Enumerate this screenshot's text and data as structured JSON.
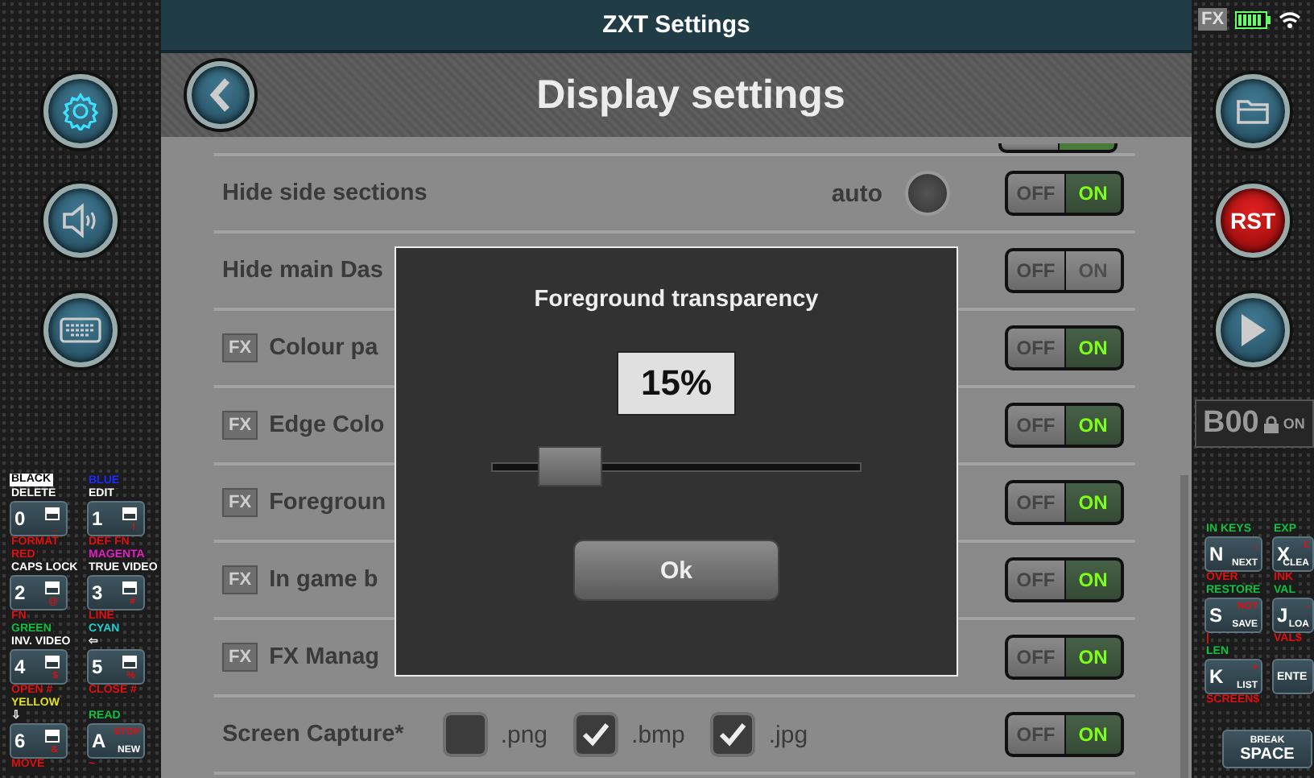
{
  "window": {
    "title": "ZXT Settings"
  },
  "header": {
    "title": "Display settings"
  },
  "settings": [
    {
      "kind": "clipped",
      "on": true
    },
    {
      "kind": "toggle",
      "label": "Hide side sections",
      "auto_label": "auto",
      "auto_on": false,
      "off_label": "OFF",
      "on_label": "ON",
      "on": true
    },
    {
      "kind": "toggle",
      "label": "Hide main Das",
      "off_label": "OFF",
      "on_label": "ON",
      "on": false
    },
    {
      "kind": "toggle",
      "fx": "FX",
      "label": "Colour pa",
      "off_label": "OFF",
      "on_label": "ON",
      "on": true
    },
    {
      "kind": "toggle",
      "fx": "FX",
      "label": "Edge Colo",
      "off_label": "OFF",
      "on_label": "ON",
      "on": true
    },
    {
      "kind": "toggle",
      "fx": "FX",
      "label": "Foregroun",
      "off_label": "OFF",
      "on_label": "ON",
      "on": true
    },
    {
      "kind": "toggle",
      "fx": "FX",
      "label": "In game b",
      "off_label": "OFF",
      "on_label": "ON",
      "on": true
    },
    {
      "kind": "toggle",
      "fx": "FX",
      "label": "FX Manag",
      "off_label": "OFF",
      "on_label": "ON",
      "on": true
    },
    {
      "kind": "capture",
      "label": "Screen Capture*",
      "formats": [
        {
          "label": ".png",
          "checked": false
        },
        {
          "label": ".bmp",
          "checked": true
        },
        {
          "label": ".jpg",
          "checked": true
        }
      ],
      "off_label": "OFF",
      "on_label": "ON",
      "on": true
    }
  ],
  "dialog": {
    "title": "Foreground transparency",
    "value": "15%",
    "level": 0.15,
    "button": "Ok"
  },
  "right_panel": {
    "fx_badge": "FX",
    "reset_button": "RST",
    "memory": {
      "slot": "B00",
      "state": "ON"
    }
  },
  "left_keys": [
    {
      "kind": "digit",
      "char": "0",
      "symbol": "_",
      "above": [
        {
          "text": "BLACK",
          "kind": "inverse",
          "color": "#000000"
        },
        {
          "text": "DELETE",
          "kind": "plain"
        }
      ],
      "below": {
        "text": "FORMAT",
        "color": "#e01010"
      }
    },
    {
      "kind": "digit",
      "char": "1",
      "symbol": "!",
      "above": [
        {
          "text": "BLUE",
          "kind": "plain",
          "color": "#1a2cff"
        },
        {
          "text": "EDIT",
          "kind": "plain"
        }
      ],
      "below": {
        "text": "DEF FN",
        "color": "#e01010"
      }
    },
    {
      "kind": "digit",
      "char": "2",
      "symbol": "@",
      "above": [
        {
          "text": "RED",
          "kind": "plain",
          "color": "#e01010"
        },
        {
          "text": "CAPS LOCK",
          "kind": "plain"
        }
      ],
      "below": {
        "text": "FN",
        "color": "#e01010"
      }
    },
    {
      "kind": "digit",
      "char": "3",
      "symbol": "#",
      "above": [
        {
          "text": "MAGENTA",
          "kind": "plain",
          "color": "#e020c0"
        },
        {
          "text": "TRUE VIDEO",
          "kind": "plain"
        }
      ],
      "below": {
        "text": "LINE",
        "color": "#e01010"
      }
    },
    {
      "kind": "digit",
      "char": "4",
      "symbol": "$",
      "above": [
        {
          "text": "GREEN",
          "kind": "plain",
          "color": "#10c040"
        },
        {
          "text": "INV. VIDEO",
          "kind": "plain"
        }
      ],
      "below": {
        "text": "OPEN #",
        "color": "#e01010"
      }
    },
    {
      "kind": "digit",
      "char": "5",
      "symbol": "%",
      "above": [
        {
          "text": "CYAN",
          "kind": "plain",
          "color": "#20d0d0"
        },
        {
          "text": "⇦",
          "kind": "plain"
        }
      ],
      "below": {
        "text": "CLOSE #",
        "color": "#e01010"
      }
    },
    {
      "kind": "digit",
      "char": "6",
      "symbol": "&",
      "above": [
        {
          "text": "YELLOW",
          "kind": "plain",
          "color": "#e0e020"
        },
        {
          "text": "⇩",
          "kind": "plain"
        }
      ],
      "below": {
        "text": "MOVE",
        "color": "#e01010"
      }
    },
    {
      "kind": "letter",
      "char": "A",
      "symbol": "STOP",
      "keyword": "NEW",
      "above": [
        {
          "text": "READ",
          "kind": "plain",
          "color": "#10c040"
        }
      ],
      "below": {
        "text": "~",
        "color": "#e01010"
      }
    }
  ],
  "right_keys": [
    {
      "kind": "letter",
      "char": "N",
      "symbol": ",",
      "keyword": "NEXT",
      "above": [
        {
          "text": "IN KEYS",
          "kind": "plain",
          "color": "#10c040"
        }
      ],
      "below": {
        "text": "OVER",
        "color": "#e01010"
      }
    },
    {
      "kind": "letter",
      "char": "X",
      "symbol": "£",
      "keyword": "CLEA",
      "above": [
        {
          "text": "EXP",
          "kind": "plain",
          "color": "#10c040"
        }
      ],
      "below": {
        "text": "INK",
        "color": "#e01010"
      }
    },
    {
      "kind": "letter",
      "char": "S",
      "symbol": "NOT",
      "keyword": "SAVE",
      "above": [
        {
          "text": "RESTORE",
          "kind": "plain",
          "color": "#10c040"
        }
      ],
      "below": {
        "text": "|",
        "color": "#e01010"
      }
    },
    {
      "kind": "letter",
      "char": "J",
      "symbol": "-",
      "keyword": "LOA",
      "above": [
        {
          "text": "VAL",
          "kind": "plain",
          "color": "#10c040"
        }
      ],
      "below": {
        "text": "VAL$",
        "color": "#e01010"
      }
    },
    {
      "kind": "letter",
      "char": "K",
      "symbol": "+",
      "keyword": "LIST",
      "above": [
        {
          "text": "LEN",
          "kind": "plain",
          "color": "#10c040"
        }
      ],
      "below": {
        "text": "SCREEN$",
        "color": "#e01010"
      }
    },
    {
      "kind": "word",
      "char": "ENTE"
    },
    {
      "kind": "wide",
      "char": "SPACE",
      "keyword": "BREAK"
    }
  ]
}
